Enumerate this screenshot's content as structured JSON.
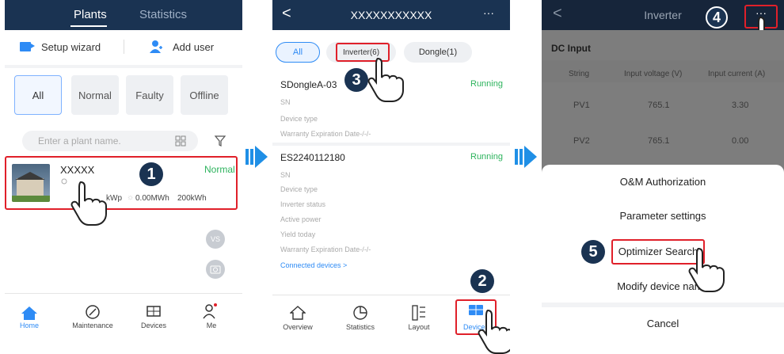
{
  "phone1": {
    "tabs": [
      "Plants",
      "Statistics"
    ],
    "setup_wizard": "Setup wizard",
    "add_user": "Add user",
    "filters": [
      "All",
      "Normal",
      "Faulty",
      "Offline"
    ],
    "search_placeholder": "Enter a plant name.",
    "plant": {
      "name": "XXXXX",
      "status": "Normal",
      "capacity_tail": "kWp",
      "energy": "0.00MWh",
      "power": "200kWh"
    },
    "side_btn": "VS",
    "nav": [
      "Home",
      "Maintenance",
      "Devices",
      "Me"
    ],
    "step": "1"
  },
  "phone2": {
    "title": "XXXXXXXXXXX",
    "more": "···",
    "filters": [
      "All",
      "Inverter(6)",
      "Dongle(1)"
    ],
    "dev1": {
      "name": "SDongleA-03",
      "status": "Running",
      "fields": [
        "SN",
        "Device type",
        "Warranty Expiration Date-/-/-"
      ]
    },
    "dev2": {
      "name": "ES2240112180",
      "status": "Running",
      "fields": [
        "SN",
        "Device type",
        "Inverter status",
        "Active power",
        "Yield today",
        "Warranty Expiration Date-/-/-"
      ],
      "link": "Connected devices >"
    },
    "nav": [
      "Overview",
      "Statistics",
      "Layout",
      "Devices"
    ],
    "steps": [
      "3",
      "2"
    ]
  },
  "phone3": {
    "title": "Inverter",
    "more": "···",
    "section": "DC Input",
    "cols": [
      "String",
      "Input voltage (V)",
      "Input current (A)"
    ],
    "rows": [
      [
        "PV1",
        "765.1",
        "3.30"
      ],
      [
        "PV2",
        "765.1",
        "0.00"
      ]
    ],
    "menu": [
      "O&M Authorization",
      "Parameter settings",
      "Optimizer Search",
      "Modify device name",
      "Cancel"
    ],
    "steps": [
      "4",
      "5"
    ]
  },
  "colors": {
    "header": "#1a3352",
    "accent": "#2e8bf5",
    "running": "#2db35d",
    "highlight": "#e0202a",
    "arrow": "#1f8fe6"
  }
}
